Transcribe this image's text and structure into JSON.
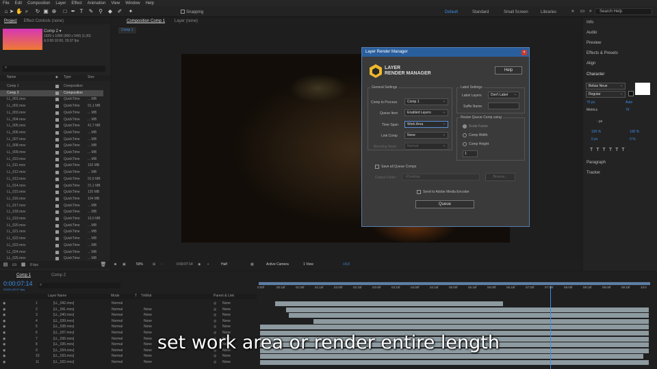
{
  "menu": [
    "File",
    "Edit",
    "Composition",
    "Layer",
    "Effect",
    "Animation",
    "View",
    "Window",
    "Help"
  ],
  "toolbar": {
    "snapping": "Snapping",
    "workspaces": [
      "Default",
      "Standard",
      "Small Screen",
      "Libraries"
    ],
    "search_placeholder": "Search Help"
  },
  "project": {
    "tabs": [
      "Project",
      "Effect Controls (none)"
    ],
    "comp_name": "Comp 2 ▾",
    "comp_res": "1920 x 1080 (960 x 540) (1,00)",
    "comp_dur": "Δ 0:00:10:00, 29,97 fps",
    "col_name": "Name",
    "col_type": "Type",
    "col_size": "Size",
    "items": [
      {
        "name": "Comp 1",
        "type": "Composition",
        "size": ""
      },
      {
        "name": "Comp 2",
        "type": "Composition",
        "size": ""
      },
      {
        "name": "LL_001.mov",
        "type": "QuickTime",
        "size": "... MB"
      },
      {
        "name": "LL_002.mov",
        "type": "QuickTime",
        "size": "91,1 MB"
      },
      {
        "name": "LL_003.mov",
        "type": "QuickTime",
        "size": "... MB"
      },
      {
        "name": "LL_004.mov",
        "type": "QuickTime",
        "size": "... MB"
      },
      {
        "name": "LL_005.mov",
        "type": "QuickTime",
        "size": "41,7 MB"
      },
      {
        "name": "LL_006.mov",
        "type": "QuickTime",
        "size": "... MB"
      },
      {
        "name": "LL_007.mov",
        "type": "QuickTime",
        "size": "... MB"
      },
      {
        "name": "LL_008.mov",
        "type": "QuickTime",
        "size": "... MB"
      },
      {
        "name": "LL_009.mov",
        "type": "QuickTime",
        "size": "... MB"
      },
      {
        "name": "LL_010.mov",
        "type": "QuickTime",
        "size": "... MB"
      },
      {
        "name": "LL_011.mov",
        "type": "QuickTime",
        "size": "102 MB"
      },
      {
        "name": "LL_012.mov",
        "type": "QuickTime",
        "size": "... MB"
      },
      {
        "name": "LL_013.mov",
        "type": "QuickTime",
        "size": "91,6 MB"
      },
      {
        "name": "LL_014.mov",
        "type": "QuickTime",
        "size": "21,1 MB"
      },
      {
        "name": "LL_015.mov",
        "type": "QuickTime",
        "size": "120 MB"
      },
      {
        "name": "LL_016.mov",
        "type": "QuickTime",
        "size": "104 MB"
      },
      {
        "name": "LL_017.mov",
        "type": "QuickTime",
        "size": "... MB"
      },
      {
        "name": "LL_018.mov",
        "type": "QuickTime",
        "size": "... MB"
      },
      {
        "name": "LL_019.mov",
        "type": "QuickTime",
        "size": "19,0 MB"
      },
      {
        "name": "LL_020.mov",
        "type": "QuickTime",
        "size": "... MB"
      },
      {
        "name": "LL_021.mov",
        "type": "QuickTime",
        "size": "... MB"
      },
      {
        "name": "LL_022.mov",
        "type": "QuickTime",
        "size": "... MB"
      },
      {
        "name": "LL_023.mov",
        "type": "QuickTime",
        "size": "... MB"
      },
      {
        "name": "LL_024.mov",
        "type": "QuickTime",
        "size": "... MB"
      },
      {
        "name": "LL_025.mov",
        "type": "QuickTime",
        "size": "... MB"
      }
    ],
    "bpc": "8 bpc"
  },
  "comp": {
    "tab": "Composition Comp 1",
    "layer_tab": "Layer (none)",
    "sub_tab": "Comp 1",
    "zoom": "50%",
    "timecode": "0:00:07:14",
    "resolution": "Half",
    "camera": "Active Camera",
    "view": "1 View",
    "exposure": "+0,0"
  },
  "dialog": {
    "title": "Layer Render Manager",
    "logo_line1": "LAYER",
    "logo_line2": "RENDER MANAGER",
    "help": "Help",
    "general": "General Settings",
    "comp_to_process_label": "Comp to Process",
    "comp_to_process": "Comp 1",
    "queue_item_label": "Queue Item",
    "queue_item": "Enabled Layers",
    "time_span_label": "Time Span",
    "time_span": "Work Area",
    "link_comp_label": "Link Comp",
    "link_comp": "None",
    "blending_label": "Blending Mode",
    "blending": "Normal",
    "label_settings": "Label Settings",
    "label_layers_label": "Label Layers",
    "label_layers": "Don't Label",
    "suffix_label": "Suffix Name",
    "resize_label": "Resize Queue Comp using",
    "scale_factor": "Scale Factor",
    "comp_width": "Comp Width",
    "comp_height": "Comp Height",
    "scale_value": "1",
    "save_all": "Save all Queue Comps",
    "output_folder_label": "Output Folder",
    "output_folder": "~/Desktop",
    "browse": "Browse...",
    "send_ame": "Send to Adobe Media Encoder",
    "queue": "Queue"
  },
  "right": {
    "panels": [
      "Info",
      "Audio",
      "Preview",
      "Effects & Presets",
      "Align",
      "Character"
    ],
    "font": "Bebas Neue",
    "style": "Regular",
    "font_size": "76 px",
    "leading": "Auto",
    "kerning": "Metrics",
    "tracking": "76",
    "px": "- px",
    "scale_v": "100 %",
    "scale_h": "100 %",
    "baseline": "0 px",
    "tsume": "0 %",
    "more_panels": [
      "Paragraph",
      "Tracker"
    ]
  },
  "timeline": {
    "tabs": [
      "Comp 1",
      "Comp 2"
    ],
    "time": "0:00:07:14",
    "frames": "00224 (29.97 fps)",
    "headers": [
      "Layer Name",
      "Mode",
      "T",
      "TrkMat",
      "Parent & Link"
    ],
    "layers": [
      {
        "n": "1",
        "name": "[LL_042.mov]",
        "mode": "Normal",
        "trk": "",
        "parent": "None"
      },
      {
        "n": "2",
        "name": "[LL_041.mov]",
        "mode": "Normal",
        "trk": "None",
        "parent": "None"
      },
      {
        "n": "3",
        "name": "[LL_040.mov]",
        "mode": "Normal",
        "trk": "None",
        "parent": "None"
      },
      {
        "n": "4",
        "name": "[LL_039.mov]",
        "mode": "Normal",
        "trk": "None",
        "parent": "None"
      },
      {
        "n": "5",
        "name": "[LL_038.mov]",
        "mode": "Normal",
        "trk": "None",
        "parent": "None"
      },
      {
        "n": "6",
        "name": "[LL_037.mov]",
        "mode": "Normal",
        "trk": "None",
        "parent": "None"
      },
      {
        "n": "7",
        "name": "[LL_036.mov]",
        "mode": "Normal",
        "trk": "None",
        "parent": "None"
      },
      {
        "n": "8",
        "name": "[LL_035.mov]",
        "mode": "Normal",
        "trk": "None",
        "parent": "None"
      },
      {
        "n": "9",
        "name": "[LL_034.mov]",
        "mode": "Normal",
        "trk": "None",
        "parent": "None"
      },
      {
        "n": "10",
        "name": "[LL_033.mov]",
        "mode": "Normal",
        "trk": "None",
        "parent": "None"
      },
      {
        "n": "11",
        "name": "[LL_032.mov]",
        "mode": "Normal",
        "trk": "None",
        "parent": "None"
      }
    ],
    "ruler": [
      "0:00f",
      "00:15f",
      "01:00f",
      "01:15f",
      "02:00f",
      "02:15f",
      "03:00f",
      "03:15f",
      "04:00f",
      "04:15f",
      "05:00f",
      "05:15f",
      "06:00f",
      "06:15f",
      "07:00f",
      "07:15f",
      "08:00f",
      "08:15f",
      "09:00f",
      "09:15f",
      "10:0"
    ]
  },
  "caption": "set work area or render entire length"
}
